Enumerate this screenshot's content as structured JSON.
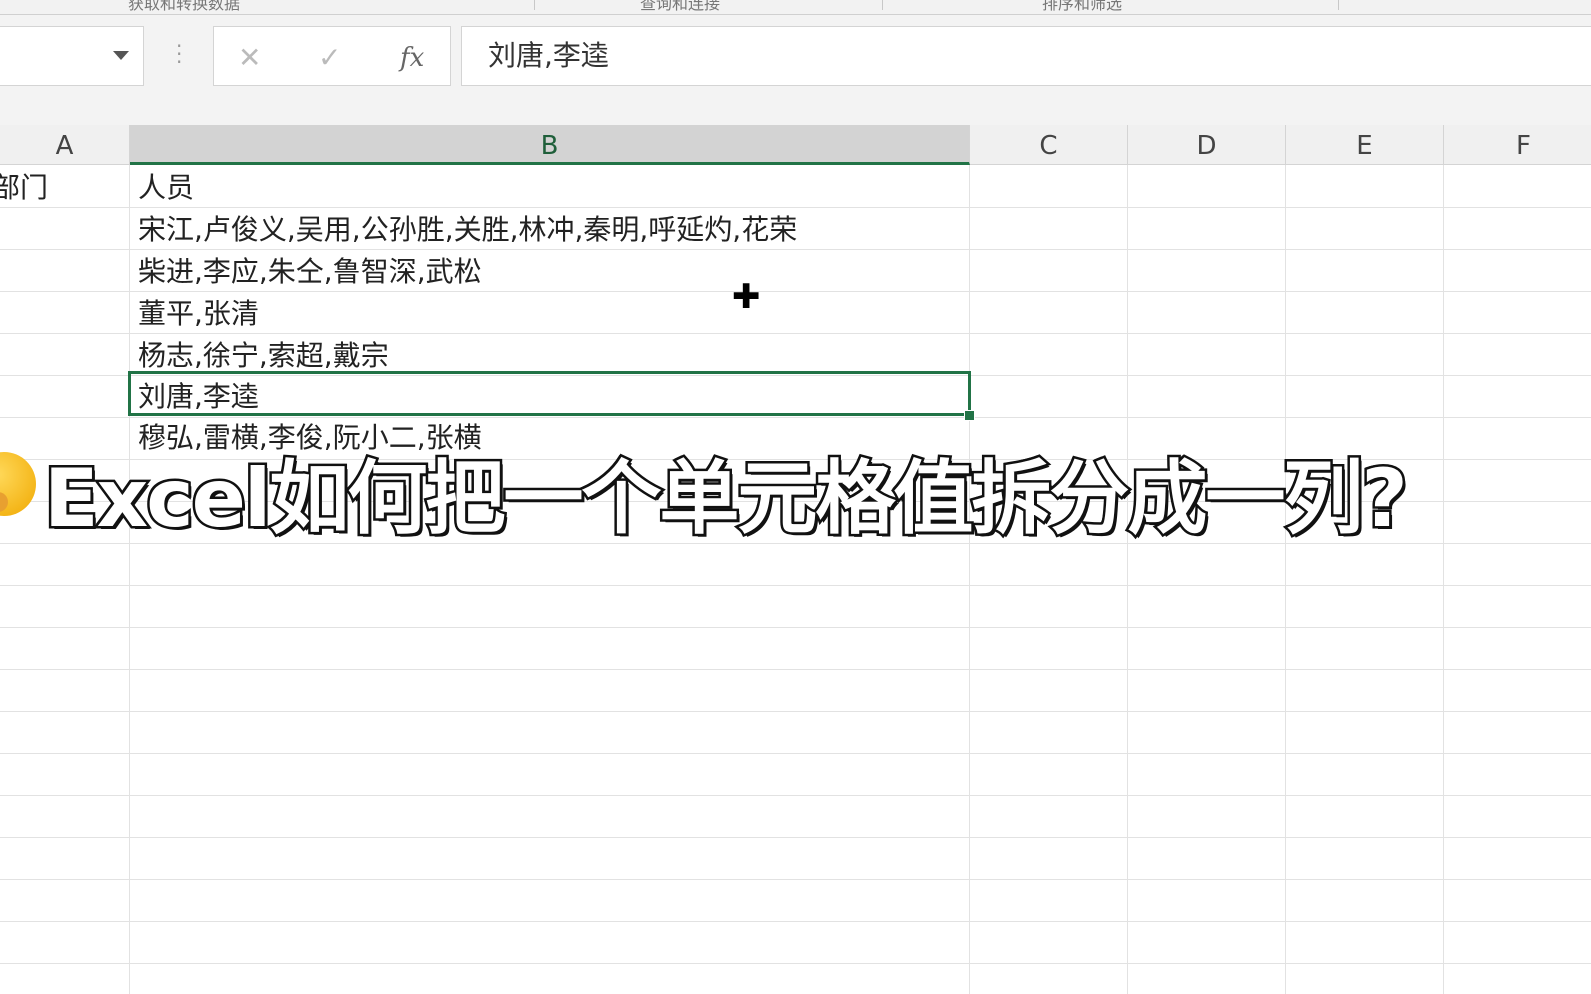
{
  "ribbon": {
    "groups": [
      "获取和转换数据",
      "查询和连接",
      "排序和筛选"
    ]
  },
  "formula_bar": {
    "name_box": "",
    "cancel_icon": "✕",
    "enter_icon": "✓",
    "fx_label": "fx",
    "value": "刘唐,李逵"
  },
  "columns": [
    "A",
    "B",
    "C",
    "D",
    "E",
    "F"
  ],
  "selected_column": "B",
  "rows": [
    {
      "a": "部门",
      "b": "人员"
    },
    {
      "a": "",
      "b": "宋江,卢俊义,吴用,公孙胜,关胜,林冲,秦明,呼延灼,花荣"
    },
    {
      "a": "",
      "b": "柴进,李应,朱仝,鲁智深,武松"
    },
    {
      "a": "",
      "b": "董平,张清"
    },
    {
      "a": "",
      "b": "杨志,徐宁,索超,戴宗"
    },
    {
      "a": "",
      "b": "刘唐,李逵"
    },
    {
      "a": "",
      "b": "穆弘,雷横,李俊,阮小二,张横"
    }
  ],
  "caption": "Excel如何把一个单元格值拆分成一列?",
  "colors": {
    "accent": "#217346"
  }
}
